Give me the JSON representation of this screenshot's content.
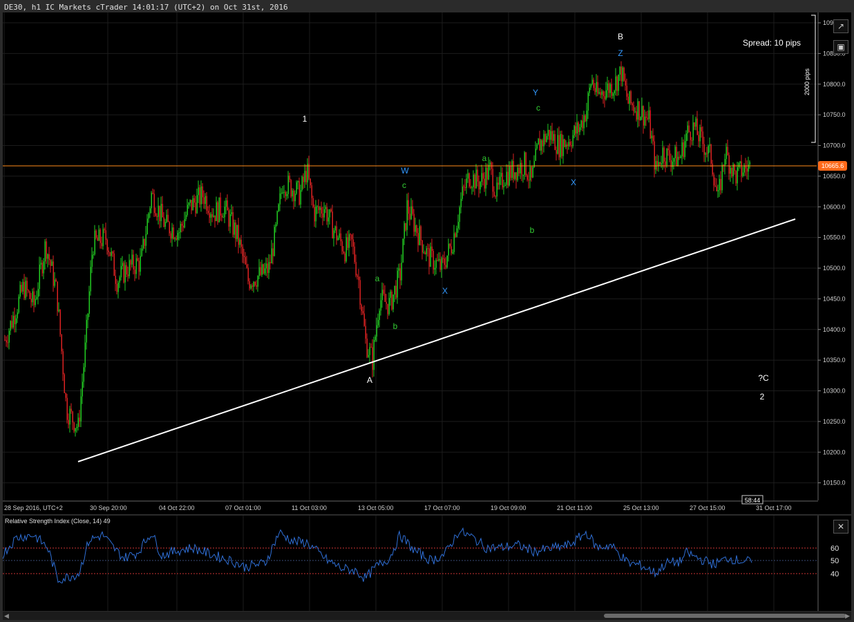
{
  "window": {
    "title": "DE30, h1 IC Markets cTrader 14:01:17 (UTC+2) on Oct 31st, 2016"
  },
  "chart": {
    "spread_label": "Spread: 10 pips",
    "range_label": "2000 pips",
    "current_price": "10665.6",
    "countdown": "58:44",
    "price_ticks": [
      "10900.0",
      "10850.0",
      "10800.0",
      "10750.0",
      "10700.0",
      "10650.0",
      "10600.0",
      "10550.0",
      "10500.0",
      "10450.0",
      "10400.0",
      "10350.0",
      "10300.0",
      "10250.0",
      "10200.0",
      "10150.0"
    ],
    "time_ticks": [
      "28 Sep 2016, UTC+2",
      "30 Sep 20:00",
      "04 Oct 22:00",
      "07 Oct 01:00",
      "11 Oct 03:00",
      "13 Oct 05:00",
      "17 Oct 07:00",
      "19 Oct 09:00",
      "21 Oct 11:00",
      "25 Oct 13:00",
      "27 Oct 15:00",
      "31 Oct 17:00"
    ],
    "wave_labels": [
      {
        "text": "1",
        "color": "#ffffff"
      },
      {
        "text": "A",
        "color": "#ffffff"
      },
      {
        "text": "B",
        "color": "#ffffff"
      },
      {
        "text": "?C",
        "color": "#ffffff"
      },
      {
        "text": "2",
        "color": "#ffffff"
      },
      {
        "text": "W",
        "color": "#3399ff"
      },
      {
        "text": "X",
        "color": "#3399ff"
      },
      {
        "text": "Y",
        "color": "#3399ff"
      },
      {
        "text": "X",
        "color": "#3399ff"
      },
      {
        "text": "Z",
        "color": "#3399ff"
      },
      {
        "text": "a",
        "color": "#33cc33"
      },
      {
        "text": "b",
        "color": "#33cc33"
      },
      {
        "text": "c",
        "color": "#33cc33"
      },
      {
        "text": "a",
        "color": "#33cc33"
      },
      {
        "text": "b",
        "color": "#33cc33"
      },
      {
        "text": "c",
        "color": "#33cc33"
      }
    ],
    "colors": {
      "up": "#22cc22",
      "down": "#dd2222",
      "price_line": "#ff8c1a",
      "trend_line": "#ffffff",
      "wave_blue": "#3399ff",
      "wave_green": "#33cc33"
    },
    "icons": [
      "external-link-icon",
      "camera-icon"
    ]
  },
  "rsi": {
    "label": "Relative Strength Index (Close, 14) 49",
    "levels": [
      "60",
      "50",
      "40"
    ],
    "colors": {
      "line": "#2f6fd6",
      "levels": "#cc3333"
    }
  },
  "scrollbar": {
    "icons": [
      "scroll-left-icon",
      "scroll-right-icon"
    ]
  }
}
